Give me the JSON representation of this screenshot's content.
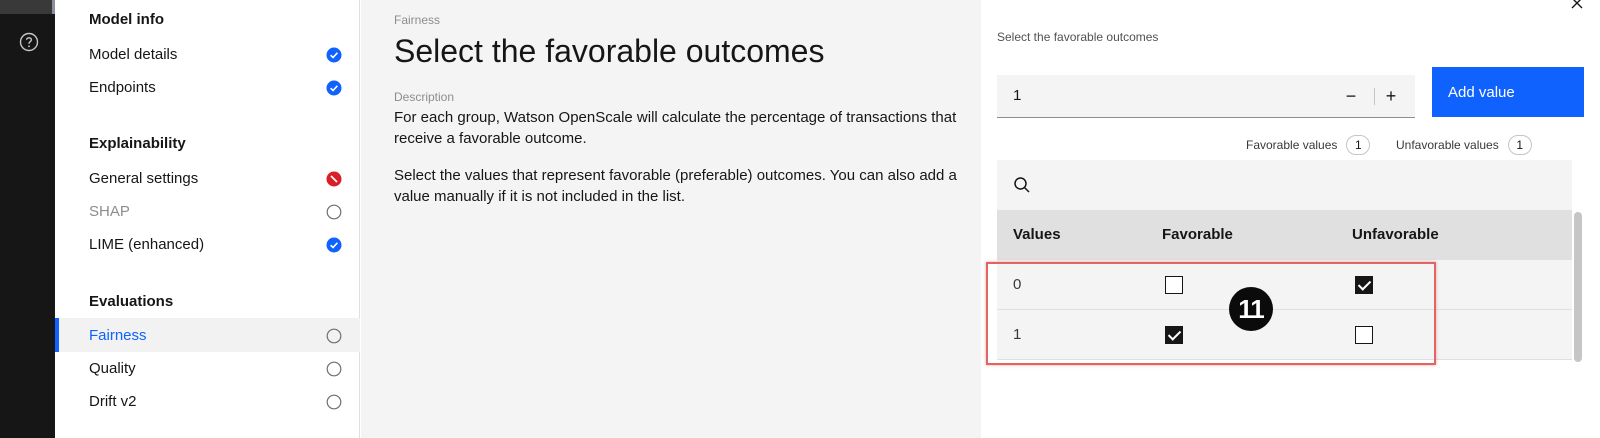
{
  "sidebar": {
    "sections": [
      {
        "title": "Model info"
      },
      {
        "title": "Explainability"
      },
      {
        "title": "Evaluations"
      }
    ],
    "items": [
      {
        "label": "Model details",
        "status": "complete"
      },
      {
        "label": "Endpoints",
        "status": "complete"
      },
      {
        "label": "General settings",
        "status": "error"
      },
      {
        "label": "SHAP",
        "status": "not-started"
      },
      {
        "label": "LIME (enhanced)",
        "status": "complete"
      },
      {
        "label": "Fairness",
        "status": "not-started"
      },
      {
        "label": "Quality",
        "status": "not-started"
      },
      {
        "label": "Drift v2",
        "status": "not-started"
      }
    ]
  },
  "main": {
    "eyebrow": "Fairness",
    "title": "Select the favorable outcomes",
    "description_label": "Description",
    "paragraph_1": "For each group, Watson OpenScale will calculate the percentage of transactions that receive a favorable outcome.",
    "paragraph_2": "Select the values that represent favorable (preferable) outcomes. You can also add a value manually if it is not included in the list."
  },
  "panel": {
    "label": "Select the favorable outcomes",
    "input_value": "1",
    "decrement": "−",
    "increment": "+",
    "add_button": "Add value",
    "favorable_label": "Favorable values",
    "favorable_count": "1",
    "unfavorable_label": "Unfavorable values",
    "unfavorable_count": "1",
    "table": {
      "headers": [
        "Values",
        "Favorable",
        "Unfavorable"
      ],
      "rows": [
        {
          "value": "0",
          "favorable": false,
          "unfavorable": true
        },
        {
          "value": "1",
          "favorable": true,
          "unfavorable": false
        }
      ]
    }
  },
  "annotation": {
    "step": "11"
  },
  "colors": {
    "accent": "#0f62fe",
    "error": "#da1e28",
    "highlight": "#e06666"
  }
}
